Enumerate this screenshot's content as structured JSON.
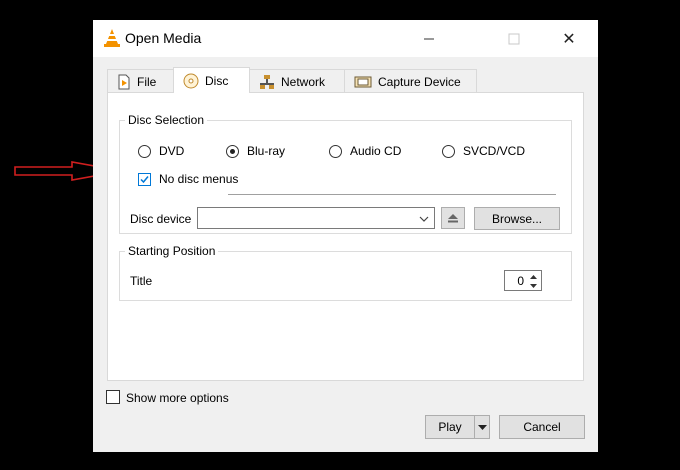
{
  "window": {
    "title": "Open Media",
    "close_glyph": "✕"
  },
  "tabs": [
    {
      "label": "File",
      "icon": "file-icon"
    },
    {
      "label": "Disc",
      "icon": "disc-icon",
      "active": true
    },
    {
      "label": "Network",
      "icon": "network-icon"
    },
    {
      "label": "Capture Device",
      "icon": "capture-device-icon"
    }
  ],
  "disc_selection": {
    "legend": "Disc Selection",
    "options": [
      "DVD",
      "Blu-ray",
      "Audio CD",
      "SVCD/VCD"
    ],
    "selected": "Blu-ray",
    "no_menus_label": "No disc menus",
    "no_menus_checked": true,
    "device_label": "Disc device",
    "device_value": "",
    "browse_label": "Browse..."
  },
  "starting_position": {
    "legend": "Starting Position",
    "title_label": "Title",
    "title_value": "0"
  },
  "footer": {
    "show_more_label": "Show more options",
    "play_label": "Play",
    "cancel_label": "Cancel"
  },
  "annotation": {
    "arrow_color": "#d11f1f"
  },
  "colors": {
    "accent": "#0078d7",
    "cone": "#f39200"
  }
}
